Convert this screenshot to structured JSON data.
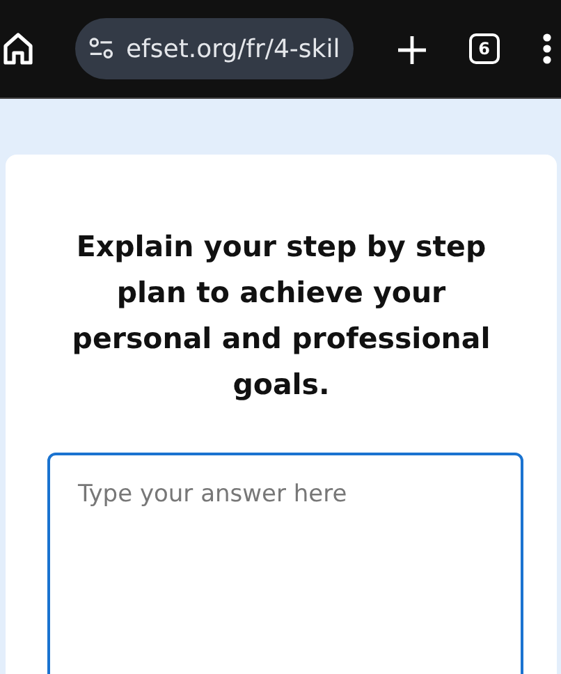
{
  "browser": {
    "url": "efset.org/fr/4-skil",
    "tab_count": "6"
  },
  "question": {
    "prompt": "Explain your step by step plan to achieve your personal and professional goals."
  },
  "answer": {
    "placeholder": "Type your answer here",
    "focused": true
  }
}
